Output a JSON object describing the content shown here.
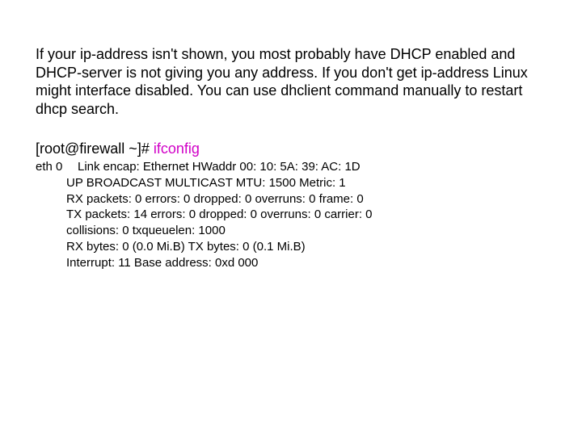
{
  "intro": "If your ip-address isn't shown, you most probably have DHCP enabled and DHCP-server is not giving you any address. If you don't get ip-address Linux might interface disabled. You can use dhclient command manually to restart dhcp search.",
  "prompt": "[root@firewall ~]# ",
  "command": "ifconfig",
  "output": {
    "iface": "eth 0",
    "line1": "Link encap: Ethernet  HWaddr 00: 10: 5A: 39: AC: 1D",
    "line2": "UP BROADCAST MULTICAST  MTU: 1500  Metric: 1",
    "line3": "RX packets: 0 errors: 0 dropped: 0 overruns: 0 frame: 0",
    "line4": "TX packets: 14 errors: 0 dropped: 0 overruns: 0 carrier: 0",
    "line5": "collisions: 0 txqueuelen: 1000",
    "line6": "RX bytes: 0 (0.0 Mi.B)  TX bytes: 0 (0.1 Mi.B)",
    "line7": "Interrupt: 11 Base address: 0xd 000"
  }
}
